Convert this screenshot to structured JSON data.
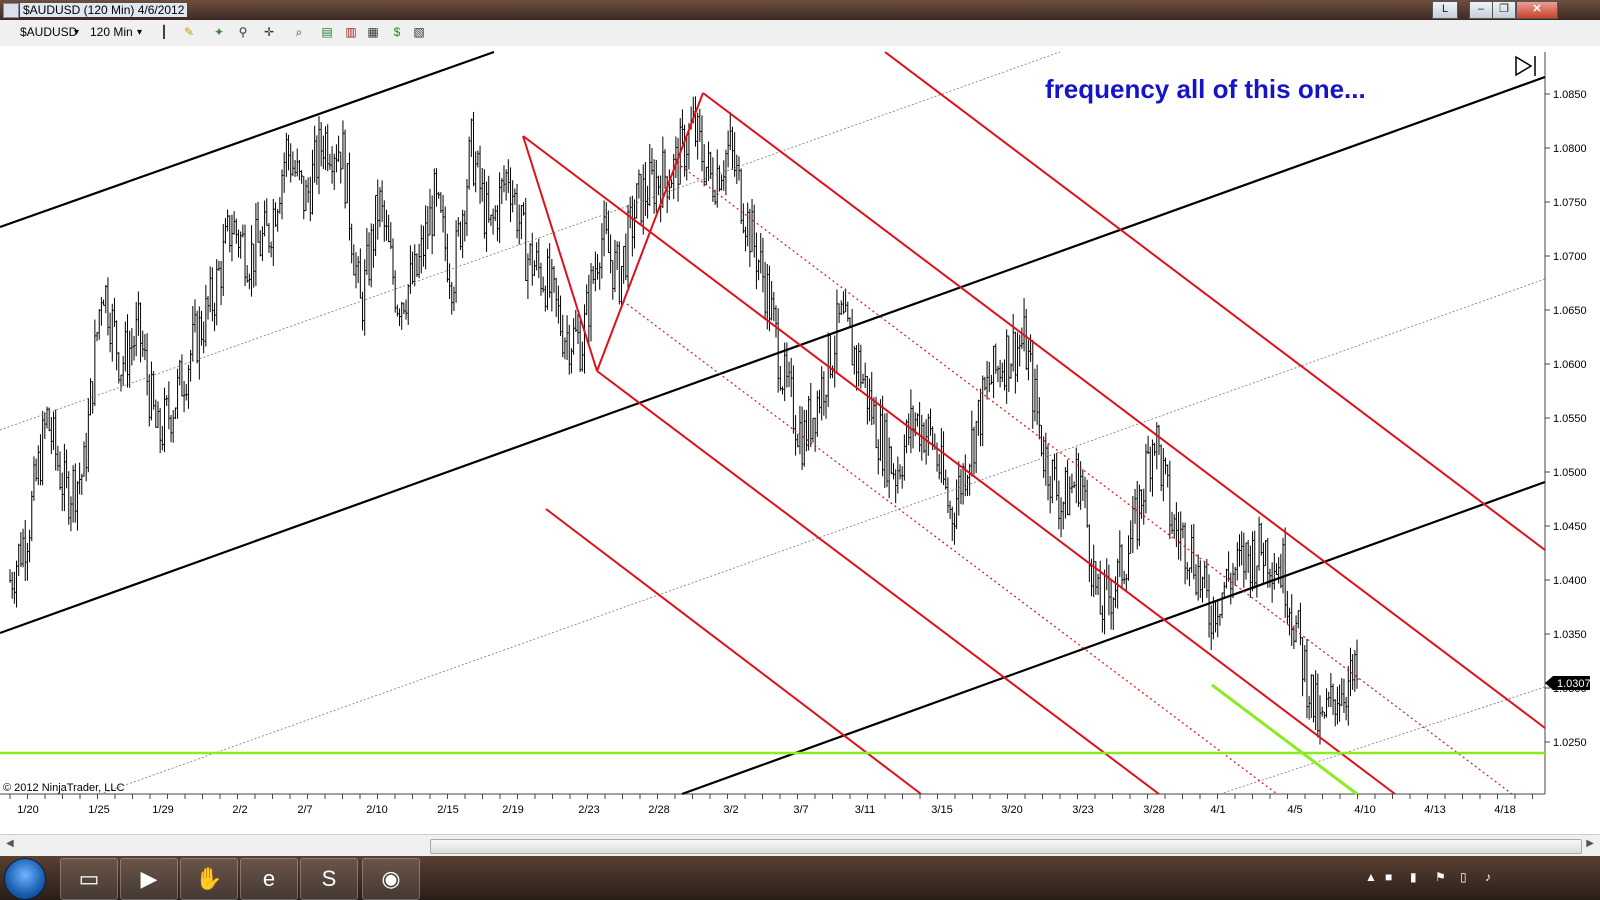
{
  "window": {
    "title": "$AUDUSD (120 Min)  4/6/2012",
    "btn_l": "L",
    "btn_min": "–",
    "btn_max": "❐",
    "btn_close": "✕"
  },
  "toolbar": {
    "instrument": "$AUDUSD",
    "interval": "120 Min",
    "dropdown_arrow": "▾",
    "icons": [
      "bar-type-icon",
      "pencil-draw-icon",
      "magic-wand-icon",
      "pin-icon",
      "crosshair-icon",
      "zoom-icon",
      "data-box-icon",
      "strategy-icon",
      "chart-properties-icon",
      "money-icon",
      "indicator-icon"
    ]
  },
  "chart": {
    "annotation": "frequency all of this one...",
    "copyright": "© 2012 NinjaTrader, LLC",
    "current_price": "1.0307",
    "x_labels": [
      "1/20",
      "1/25",
      "1/29",
      "2/2",
      "2/7",
      "2/10",
      "2/15",
      "2/19",
      "2/23",
      "2/28",
      "3/2",
      "3/7",
      "3/11",
      "3/15",
      "3/20",
      "3/23",
      "3/28",
      "4/1",
      "4/5",
      "4/10",
      "4/13",
      "4/18"
    ],
    "y_labels": [
      "1.0850",
      "1.0800",
      "1.0750",
      "1.0700",
      "1.0650",
      "1.0600",
      "1.0550",
      "1.0500",
      "1.0450",
      "1.0400",
      "1.0350",
      "1.0300",
      "1.0250"
    ],
    "colors": {
      "pitchfork": "#e0101a",
      "channel": "#000000",
      "support": "#88ee22",
      "annotation": "#1414c8"
    }
  },
  "chart_data": {
    "type": "ohlc",
    "title": "",
    "symbol": "$AUDUSD",
    "interval": "120 Min",
    "ylim": [
      1.0215,
      1.0895
    ],
    "y_ticks": [
      1.085,
      1.08,
      1.075,
      1.07,
      1.065,
      1.06,
      1.055,
      1.05,
      1.045,
      1.04,
      1.035,
      1.03,
      1.025
    ],
    "last_price": 1.0307,
    "close_path": [
      [
        "1/20",
        1.04
      ],
      [
        "1/22",
        1.045
      ],
      [
        "1/23",
        1.055
      ],
      [
        "1/24",
        1.048
      ],
      [
        "1/25",
        1.05
      ],
      [
        "1/26",
        1.068
      ],
      [
        "1/27",
        1.06
      ],
      [
        "1/28",
        1.063
      ],
      [
        "1/29",
        1.053
      ],
      [
        "1/30",
        1.057
      ],
      [
        "1/31",
        1.062
      ],
      [
        "2/1",
        1.066
      ],
      [
        "2/2",
        1.073
      ],
      [
        "2/3",
        1.07
      ],
      [
        "2/5",
        1.072
      ],
      [
        "2/6",
        1.08
      ],
      [
        "2/7",
        1.075
      ],
      [
        "2/8",
        1.081
      ],
      [
        "2/9",
        1.08
      ],
      [
        "2/10",
        1.065
      ],
      [
        "2/12",
        1.075
      ],
      [
        "2/13",
        1.066
      ],
      [
        "2/14",
        1.068
      ],
      [
        "2/15",
        1.075
      ],
      [
        "2/16",
        1.068
      ],
      [
        "2/17",
        1.08
      ],
      [
        "2/18",
        1.072
      ],
      [
        "2/19",
        1.078
      ],
      [
        "2/20",
        1.07
      ],
      [
        "2/21",
        1.068
      ],
      [
        "2/22",
        1.063
      ],
      [
        "2/23",
        1.062
      ],
      [
        "2/24",
        1.072
      ],
      [
        "2/25",
        1.068
      ],
      [
        "2/26",
        1.075
      ],
      [
        "2/27",
        1.077
      ],
      [
        "2/28",
        1.078
      ],
      [
        "2/29",
        1.082
      ],
      [
        "3/1",
        1.077
      ],
      [
        "3/2",
        1.08
      ],
      [
        "3/3",
        1.073
      ],
      [
        "3/5",
        1.067
      ],
      [
        "3/6",
        1.058
      ],
      [
        "3/7",
        1.053
      ],
      [
        "3/8",
        1.058
      ],
      [
        "3/9",
        1.064
      ],
      [
        "3/10",
        1.06
      ],
      [
        "3/11",
        1.054
      ],
      [
        "3/12",
        1.05
      ],
      [
        "3/13",
        1.055
      ],
      [
        "3/14",
        1.053
      ],
      [
        "3/15",
        1.046
      ],
      [
        "3/16",
        1.052
      ],
      [
        "3/17",
        1.058
      ],
      [
        "3/18",
        1.061
      ],
      [
        "3/19",
        1.062
      ],
      [
        "3/20",
        1.052
      ],
      [
        "3/21",
        1.047
      ],
      [
        "3/22",
        1.05
      ],
      [
        "3/23",
        1.037
      ],
      [
        "3/24",
        1.04
      ],
      [
        "3/25",
        1.045
      ],
      [
        "3/26",
        1.054
      ],
      [
        "3/27",
        1.045
      ],
      [
        "3/28",
        1.043
      ],
      [
        "3/29",
        1.037
      ],
      [
        "3/30",
        1.04
      ],
      [
        "3/31",
        1.042
      ],
      [
        "4/1",
        1.043
      ],
      [
        "4/2",
        1.041
      ],
      [
        "4/3",
        1.033
      ],
      [
        "4/4",
        1.026
      ],
      [
        "4/5",
        1.03
      ],
      [
        "4/6",
        1.0307
      ]
    ],
    "drawings": {
      "channel_lines": 3,
      "pitchfork_handle_points": [
        [
          "2/19",
          1.0815
        ],
        [
          "2/23",
          1.06
        ],
        [
          "2/29",
          1.0855
        ]
      ],
      "support_level": 1.0243
    }
  }
}
